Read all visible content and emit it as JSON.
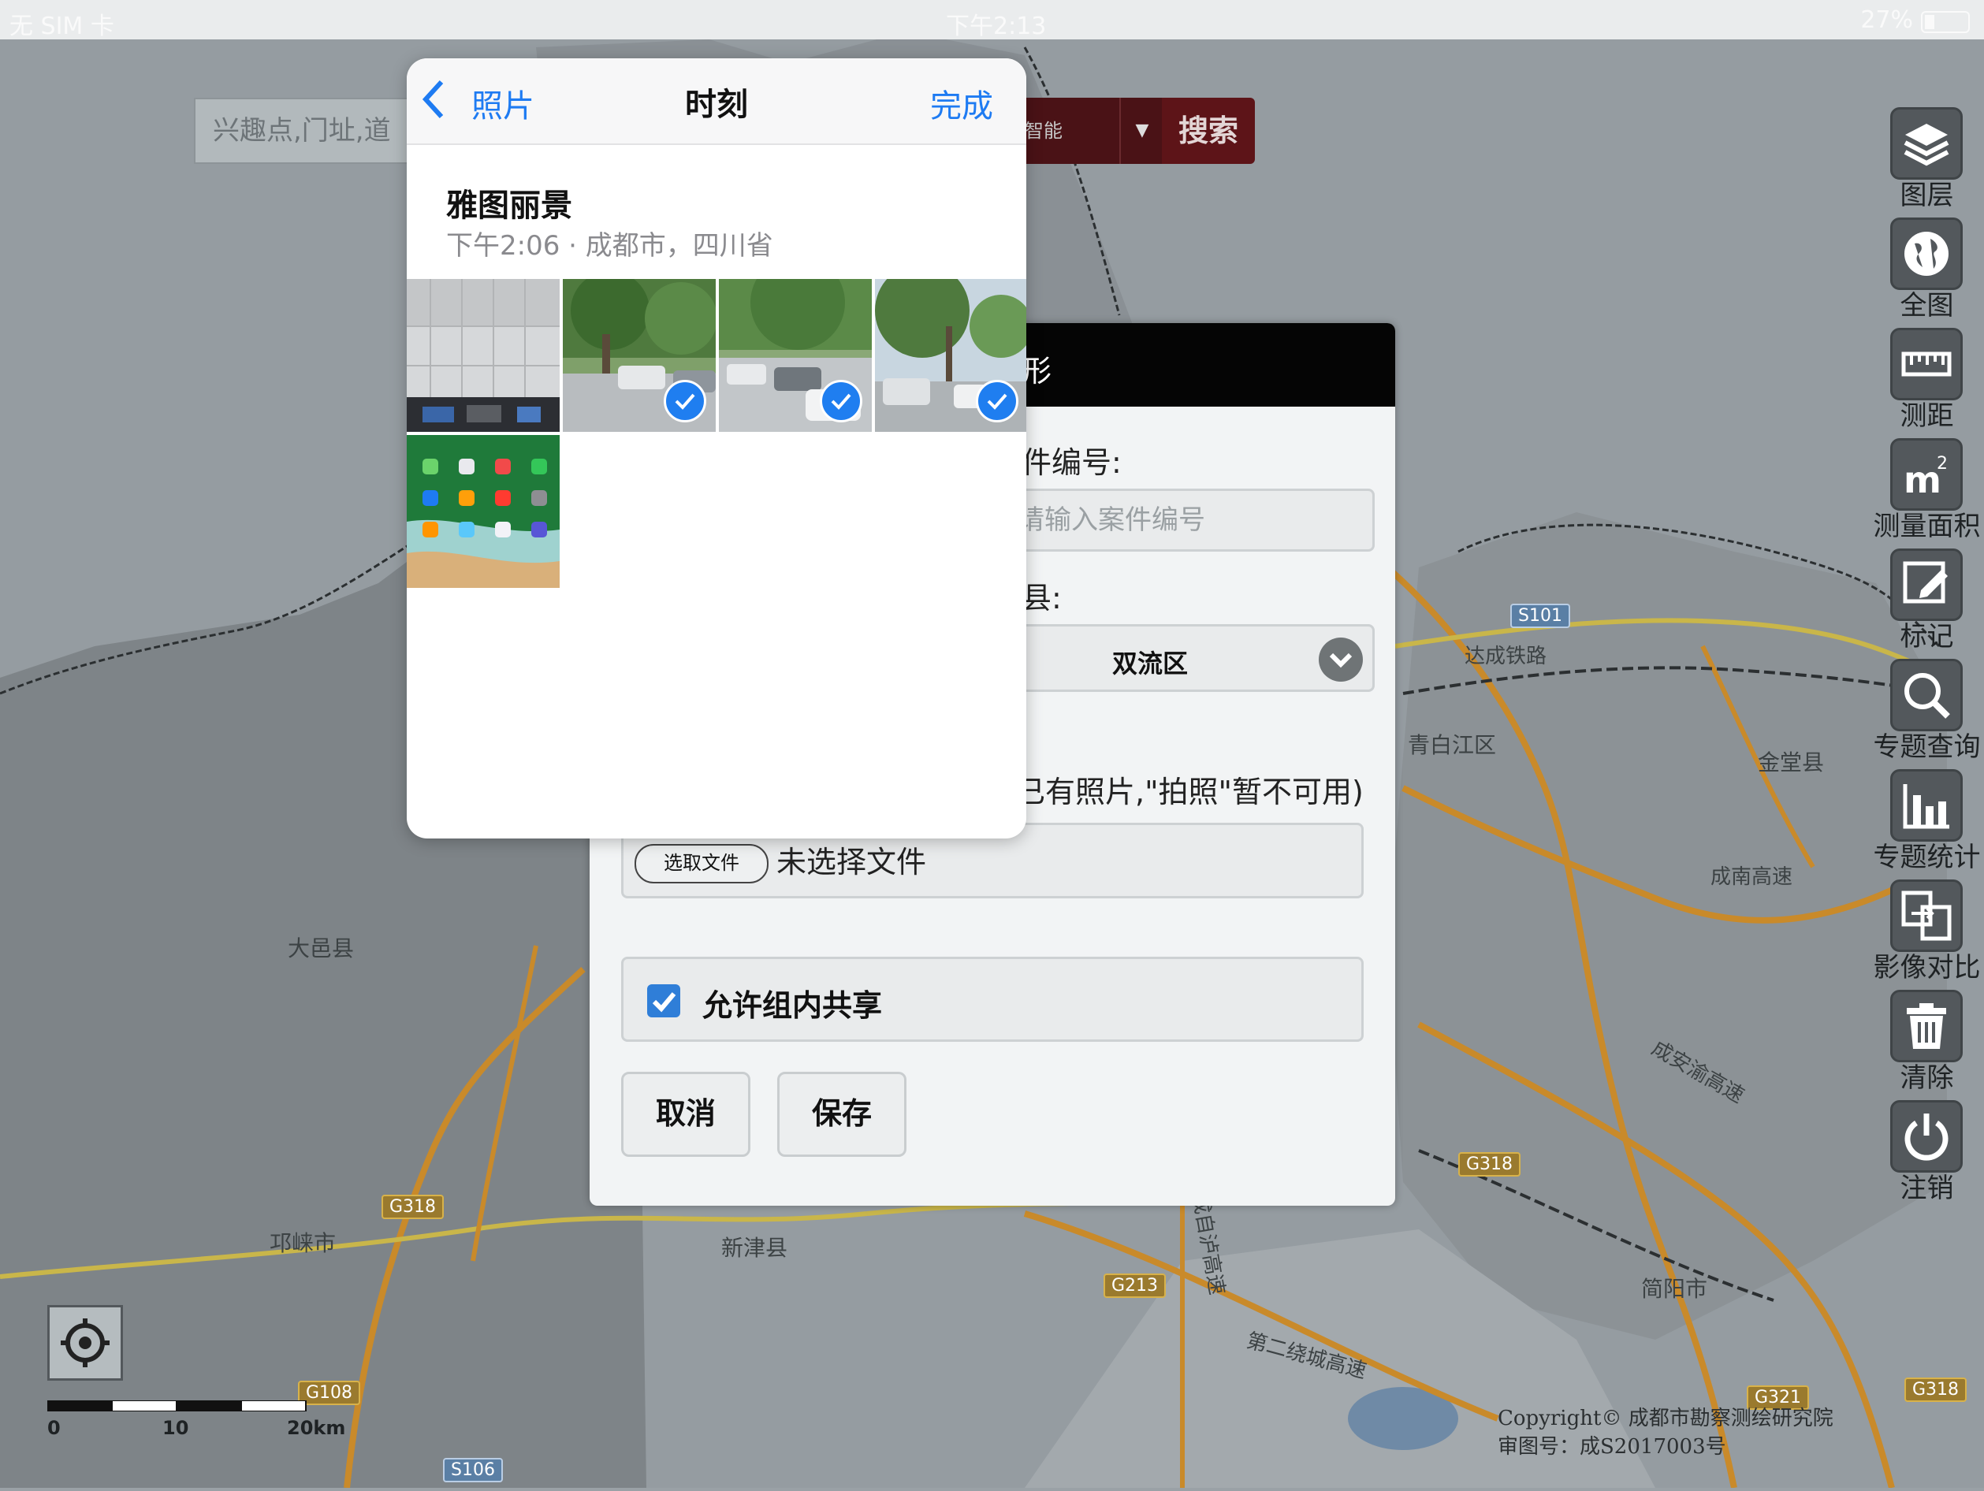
{
  "status_bar": {
    "carrier": "无 SIM 卡",
    "time": "下午2:13",
    "battery": "27%"
  },
  "search": {
    "placeholder": "兴趣点,门址,道",
    "type": "智能",
    "button_label": "搜索"
  },
  "toolbar": {
    "items": [
      {
        "label": "图层",
        "icon": "layers-icon"
      },
      {
        "label": "全图",
        "icon": "globe-icon"
      },
      {
        "label": "测距",
        "icon": "ruler-icon"
      },
      {
        "label": "测量面积",
        "icon": "area-icon"
      },
      {
        "label": "标记",
        "icon": "mark-icon"
      },
      {
        "label": "专题查询",
        "icon": "search-icon"
      },
      {
        "label": "专题统计",
        "icon": "bar-chart-icon"
      },
      {
        "label": "影像对比",
        "icon": "compare-icon"
      },
      {
        "label": "清除",
        "icon": "trash-icon"
      },
      {
        "label": "注销",
        "icon": "power-icon"
      }
    ]
  },
  "map": {
    "labels": [
      {
        "text": "大邑县"
      },
      {
        "text": "邛崃市"
      },
      {
        "text": "新津县"
      },
      {
        "text": "青白江区"
      },
      {
        "text": "金堂县"
      },
      {
        "text": "简阳市"
      },
      {
        "text": "达成铁路"
      },
      {
        "text": "成南高速"
      },
      {
        "text": "成安渝高速"
      },
      {
        "text": "成自泸高速"
      },
      {
        "text": "第二绕城高速"
      }
    ],
    "shields": [
      "G318",
      "G318",
      "G108",
      "S106",
      "G213",
      "S101",
      "G321",
      "G318"
    ],
    "scale": {
      "labels": [
        "0",
        "10",
        "20km"
      ]
    },
    "copyright_line1": "Copyright© 成都市勘察测绘研究院",
    "copyright_line2": "审图号：成S2017003号"
  },
  "form": {
    "title_fragment": "形",
    "case_label": "件编号:",
    "case_placeholder": "请输入案件编号",
    "district_label": "县:",
    "district_value": "双流区",
    "photo_hint": "已有照片,\"拍照\"暂不可用)",
    "choose_file_label": "选取文件",
    "file_status": "未选择文件",
    "share_label": "允许组内共享",
    "share_checked": true,
    "cancel_label": "取消",
    "save_label": "保存"
  },
  "picker": {
    "back_label": "照片",
    "title": "时刻",
    "done_label": "完成",
    "moment_title": "雅图丽景",
    "moment_subtitle": "下午2:06 · 成都市，四川省",
    "photos": [
      {
        "kind": "office-wall",
        "selected": false
      },
      {
        "kind": "parking-lot-trees",
        "selected": true
      },
      {
        "kind": "parking-lot-cars",
        "selected": true
      },
      {
        "kind": "parking-lot-suv",
        "selected": true
      },
      {
        "kind": "ipad-homescreen",
        "selected": false
      }
    ]
  },
  "colors": {
    "accent_blue": "#1e7bf2",
    "search_button": "#5d1418",
    "form_header": "#050505"
  }
}
